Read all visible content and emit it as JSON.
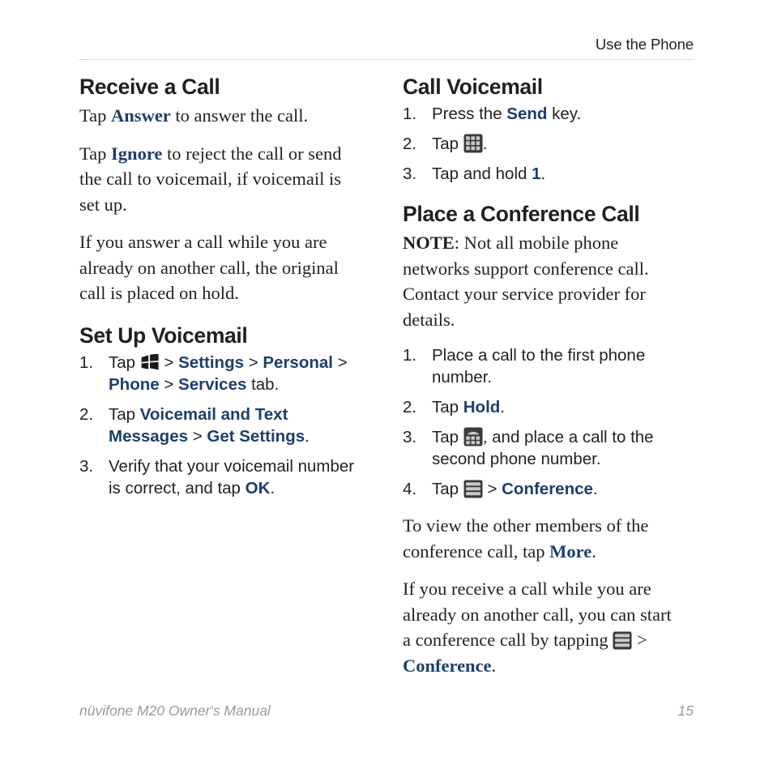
{
  "header": {
    "title": "Use the Phone"
  },
  "footer": {
    "manual_title": "nüvifone M20 Owner's Manual",
    "page_number": "15"
  },
  "colors": {
    "ui_label_blue": "#1d3f69",
    "text_black": "#231f20",
    "footer_gray": "#9a9a9a",
    "rule_gray": "#b7b7b7",
    "icon_dark": "#3a3a3a",
    "icon_light": "#c9c9c9"
  },
  "icons": {
    "start": "windows-start-flag-icon",
    "keypad": "keypad-icon",
    "conference_keypad": "conference-keypad-icon",
    "menu": "menu-bars-icon"
  },
  "left_column": {
    "sections": [
      {
        "heading": "Receive a Call",
        "paragraphs": [
          {
            "parts": [
              {
                "t": "Tap ",
                "s": "plain"
              },
              {
                "t": "Answer",
                "s": "ui"
              },
              {
                "t": " to answer the call.",
                "s": "plain"
              }
            ]
          },
          {
            "parts": [
              {
                "t": "Tap ",
                "s": "plain"
              },
              {
                "t": "Ignore",
                "s": "ui"
              },
              {
                "t": " to reject the call or send the call to voicemail, if voicemail is set up.",
                "s": "plain"
              }
            ]
          },
          {
            "parts": [
              {
                "t": "If you answer a call while you are already on another call, the original call is placed on hold.",
                "s": "plain"
              }
            ]
          }
        ]
      },
      {
        "heading": "Set Up Voicemail",
        "steps": [
          {
            "num": "1.",
            "parts": [
              {
                "t": "Tap ",
                "s": "plain"
              },
              {
                "t": "",
                "s": "icon",
                "icon": "start"
              },
              {
                "t": " > ",
                "s": "sep"
              },
              {
                "t": "Settings",
                "s": "ui"
              },
              {
                "t": " > ",
                "s": "sep"
              },
              {
                "t": "Personal",
                "s": "ui"
              },
              {
                "t": " > ",
                "s": "sep"
              },
              {
                "t": "Phone",
                "s": "ui"
              },
              {
                "t": " > ",
                "s": "sep"
              },
              {
                "t": "Services",
                "s": "ui"
              },
              {
                "t": " tab.",
                "s": "plain"
              }
            ]
          },
          {
            "num": "2.",
            "parts": [
              {
                "t": "Tap ",
                "s": "plain"
              },
              {
                "t": "Voicemail and Text Messages",
                "s": "ui"
              },
              {
                "t": " > ",
                "s": "sep"
              },
              {
                "t": "Get Settings",
                "s": "ui"
              },
              {
                "t": ".",
                "s": "plain"
              }
            ]
          },
          {
            "num": "3.",
            "parts": [
              {
                "t": "Verify that your voicemail number is correct, and tap ",
                "s": "plain"
              },
              {
                "t": "OK",
                "s": "ui"
              },
              {
                "t": ".",
                "s": "plain"
              }
            ]
          }
        ]
      }
    ]
  },
  "right_column": {
    "sections": [
      {
        "heading": "Call Voicemail",
        "steps": [
          {
            "num": "1.",
            "parts": [
              {
                "t": "Press the ",
                "s": "plain"
              },
              {
                "t": "Send",
                "s": "ui"
              },
              {
                "t": " key.",
                "s": "plain"
              }
            ]
          },
          {
            "num": "2.",
            "parts": [
              {
                "t": "Tap ",
                "s": "plain"
              },
              {
                "t": "",
                "s": "icon",
                "icon": "keypad"
              },
              {
                "t": ".",
                "s": "plain"
              }
            ]
          },
          {
            "num": "3.",
            "parts": [
              {
                "t": "Tap and hold ",
                "s": "plain"
              },
              {
                "t": "1",
                "s": "ui"
              },
              {
                "t": ".",
                "s": "plain"
              }
            ]
          }
        ]
      },
      {
        "heading": "Place a Conference Call",
        "note": {
          "label": "NOTE",
          "text": ": Not all mobile phone networks support conference call. Contact your service provider for details."
        },
        "steps": [
          {
            "num": "1.",
            "parts": [
              {
                "t": "Place a call to the first phone number.",
                "s": "plain"
              }
            ]
          },
          {
            "num": "2.",
            "parts": [
              {
                "t": "Tap ",
                "s": "plain"
              },
              {
                "t": "Hold",
                "s": "ui"
              },
              {
                "t": ".",
                "s": "plain"
              }
            ]
          },
          {
            "num": "3.",
            "parts": [
              {
                "t": "Tap ",
                "s": "plain"
              },
              {
                "t": "",
                "s": "icon",
                "icon": "conference_keypad"
              },
              {
                "t": ", and place a call to the second phone number.",
                "s": "plain"
              }
            ]
          },
          {
            "num": "4.",
            "parts": [
              {
                "t": "Tap ",
                "s": "plain"
              },
              {
                "t": "",
                "s": "icon",
                "icon": "menu"
              },
              {
                "t": " > ",
                "s": "sep"
              },
              {
                "t": "Conference",
                "s": "ui"
              },
              {
                "t": ".",
                "s": "plain"
              }
            ]
          }
        ],
        "paragraphs": [
          {
            "parts": [
              {
                "t": "To view the other members of the conference call, tap ",
                "s": "plain"
              },
              {
                "t": "More",
                "s": "ui"
              },
              {
                "t": ".",
                "s": "plain"
              }
            ]
          },
          {
            "parts": [
              {
                "t": "If you receive a call while you are already on another call, you can start a conference call by tapping ",
                "s": "plain"
              },
              {
                "t": "",
                "s": "icon",
                "icon": "menu"
              },
              {
                "t": " > ",
                "s": "plain"
              },
              {
                "t": "Conference",
                "s": "ui"
              },
              {
                "t": ".",
                "s": "plain"
              }
            ]
          }
        ]
      }
    ]
  }
}
